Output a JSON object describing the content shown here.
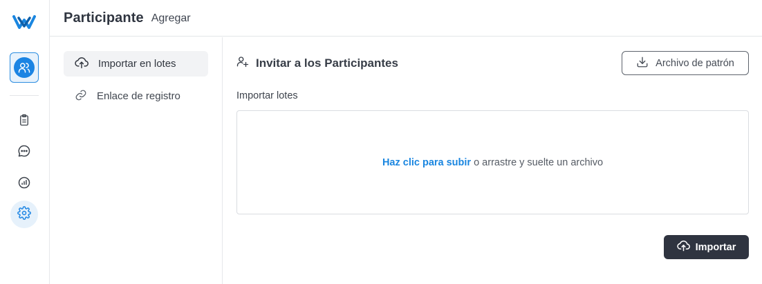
{
  "header": {
    "title": "Participante",
    "subtitle": "Agregar"
  },
  "rail": {
    "items": [
      {
        "icon": "users-icon",
        "active": true
      },
      {
        "icon": "clipboard-icon"
      },
      {
        "icon": "chat-icon"
      },
      {
        "icon": "chart-icon"
      },
      {
        "icon": "settings-icon"
      }
    ]
  },
  "subnav": {
    "items": [
      {
        "label": "Importar en lotes",
        "icon": "cloud-upload-icon",
        "active": true
      },
      {
        "label": "Enlace de registro",
        "icon": "link-icon",
        "active": false
      }
    ]
  },
  "main": {
    "section_title": "Invitar a los Participantes",
    "template_button": "Archivo de patrón",
    "field_label": "Importar lotes",
    "dropzone": {
      "link_text": "Haz clic para subir",
      "rest_text": "o arrastre y suelte un archivo"
    },
    "import_button": "Importar"
  },
  "colors": {
    "accent": "#1b84e3",
    "dark_button": "#2f3440",
    "border": "#e3e5e8"
  }
}
